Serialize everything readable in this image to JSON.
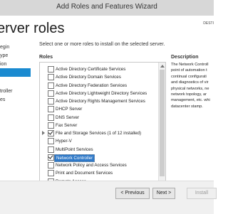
{
  "window": {
    "title": "Add Roles and Features Wizard"
  },
  "header": {
    "page_title": "erver roles",
    "destination_label": "DESTI",
    "destination_value": ""
  },
  "steps": [
    {
      "label": "egin",
      "active": false
    },
    {
      "label": "ype",
      "active": false
    },
    {
      "label": "ion",
      "active": false
    },
    {
      "label": "",
      "active": true
    },
    {
      "label": "",
      "active": false
    },
    {
      "label": "troller",
      "active": false
    },
    {
      "label": "es",
      "active": false
    }
  ],
  "content": {
    "intro": "Select one or more roles to install on the selected server.",
    "roles_label": "Roles",
    "description_label": "Description"
  },
  "roles": [
    {
      "label": "Active Directory Certificate Services",
      "checked": false,
      "expandable": false,
      "selected": false
    },
    {
      "label": "Active Directory Domain Services",
      "checked": false,
      "expandable": false,
      "selected": false
    },
    {
      "label": "Active Directory Federation Services",
      "checked": false,
      "expandable": false,
      "selected": false
    },
    {
      "label": "Active Directory Lightweight Directory Services",
      "checked": false,
      "expandable": false,
      "selected": false
    },
    {
      "label": "Active Directory Rights Management Services",
      "checked": false,
      "expandable": false,
      "selected": false
    },
    {
      "label": "DHCP Server",
      "checked": false,
      "expandable": false,
      "selected": false
    },
    {
      "label": "DNS Server",
      "checked": false,
      "expandable": false,
      "selected": false
    },
    {
      "label": "Fax Server",
      "checked": false,
      "expandable": false,
      "selected": false
    },
    {
      "label": "File and Storage Services (1 of 12 installed)",
      "checked": true,
      "expandable": true,
      "selected": false
    },
    {
      "label": "Hyper-V",
      "checked": false,
      "expandable": false,
      "selected": false
    },
    {
      "label": "MultiPoint Services",
      "checked": false,
      "expandable": false,
      "selected": false
    },
    {
      "label": "Network Controller",
      "checked": true,
      "expandable": false,
      "selected": true
    },
    {
      "label": "Network Policy and Access Services",
      "checked": false,
      "expandable": false,
      "selected": false
    },
    {
      "label": "Print and Document Services",
      "checked": false,
      "expandable": false,
      "selected": false
    },
    {
      "label": "Remote Access",
      "checked": false,
      "expandable": false,
      "selected": false
    }
  ],
  "description_lines": [
    "The Network Controll",
    "point of automation t",
    "continual configurati",
    "and diagnostics of vir",
    "physical networks, ne",
    "network topology, ar",
    "management, etc. whi",
    "datacenter stamp."
  ],
  "buttons": {
    "previous": "< Previous",
    "next": "Next >",
    "install": "Install"
  }
}
